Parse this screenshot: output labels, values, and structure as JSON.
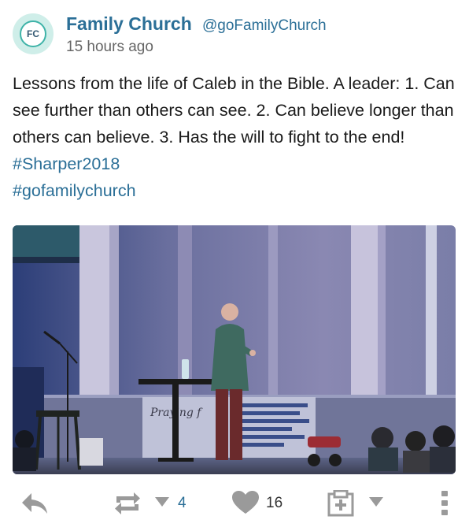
{
  "account": {
    "avatar_initials": "FC",
    "name": "Family Church",
    "handle": "@goFamilyChurch",
    "time_ago": "15 hours ago"
  },
  "post": {
    "text": "Lessons from the life of Caleb in the Bible. A leader: 1. Can see further than others can see. 2. Can believe longer than others can believe. 3. Has the will to fight to the end! ",
    "hashtags": [
      "#Sharper2018",
      "#gofamilychurch"
    ],
    "image": {
      "icon": "stage-photo",
      "banner_text": "Praying f"
    }
  },
  "actions": {
    "reply_icon": "reply-icon",
    "retweet_icon": "retweet-icon",
    "retweet_count": "4",
    "like_icon": "heart-icon",
    "like_count": "16",
    "save_icon": "add-bookmark-icon",
    "more_icon": "more-vertical-icon"
  },
  "colors": {
    "link": "#2b6f97",
    "icon_gray": "#9a9a9a",
    "avatar_ring": "#3fb3a8"
  }
}
